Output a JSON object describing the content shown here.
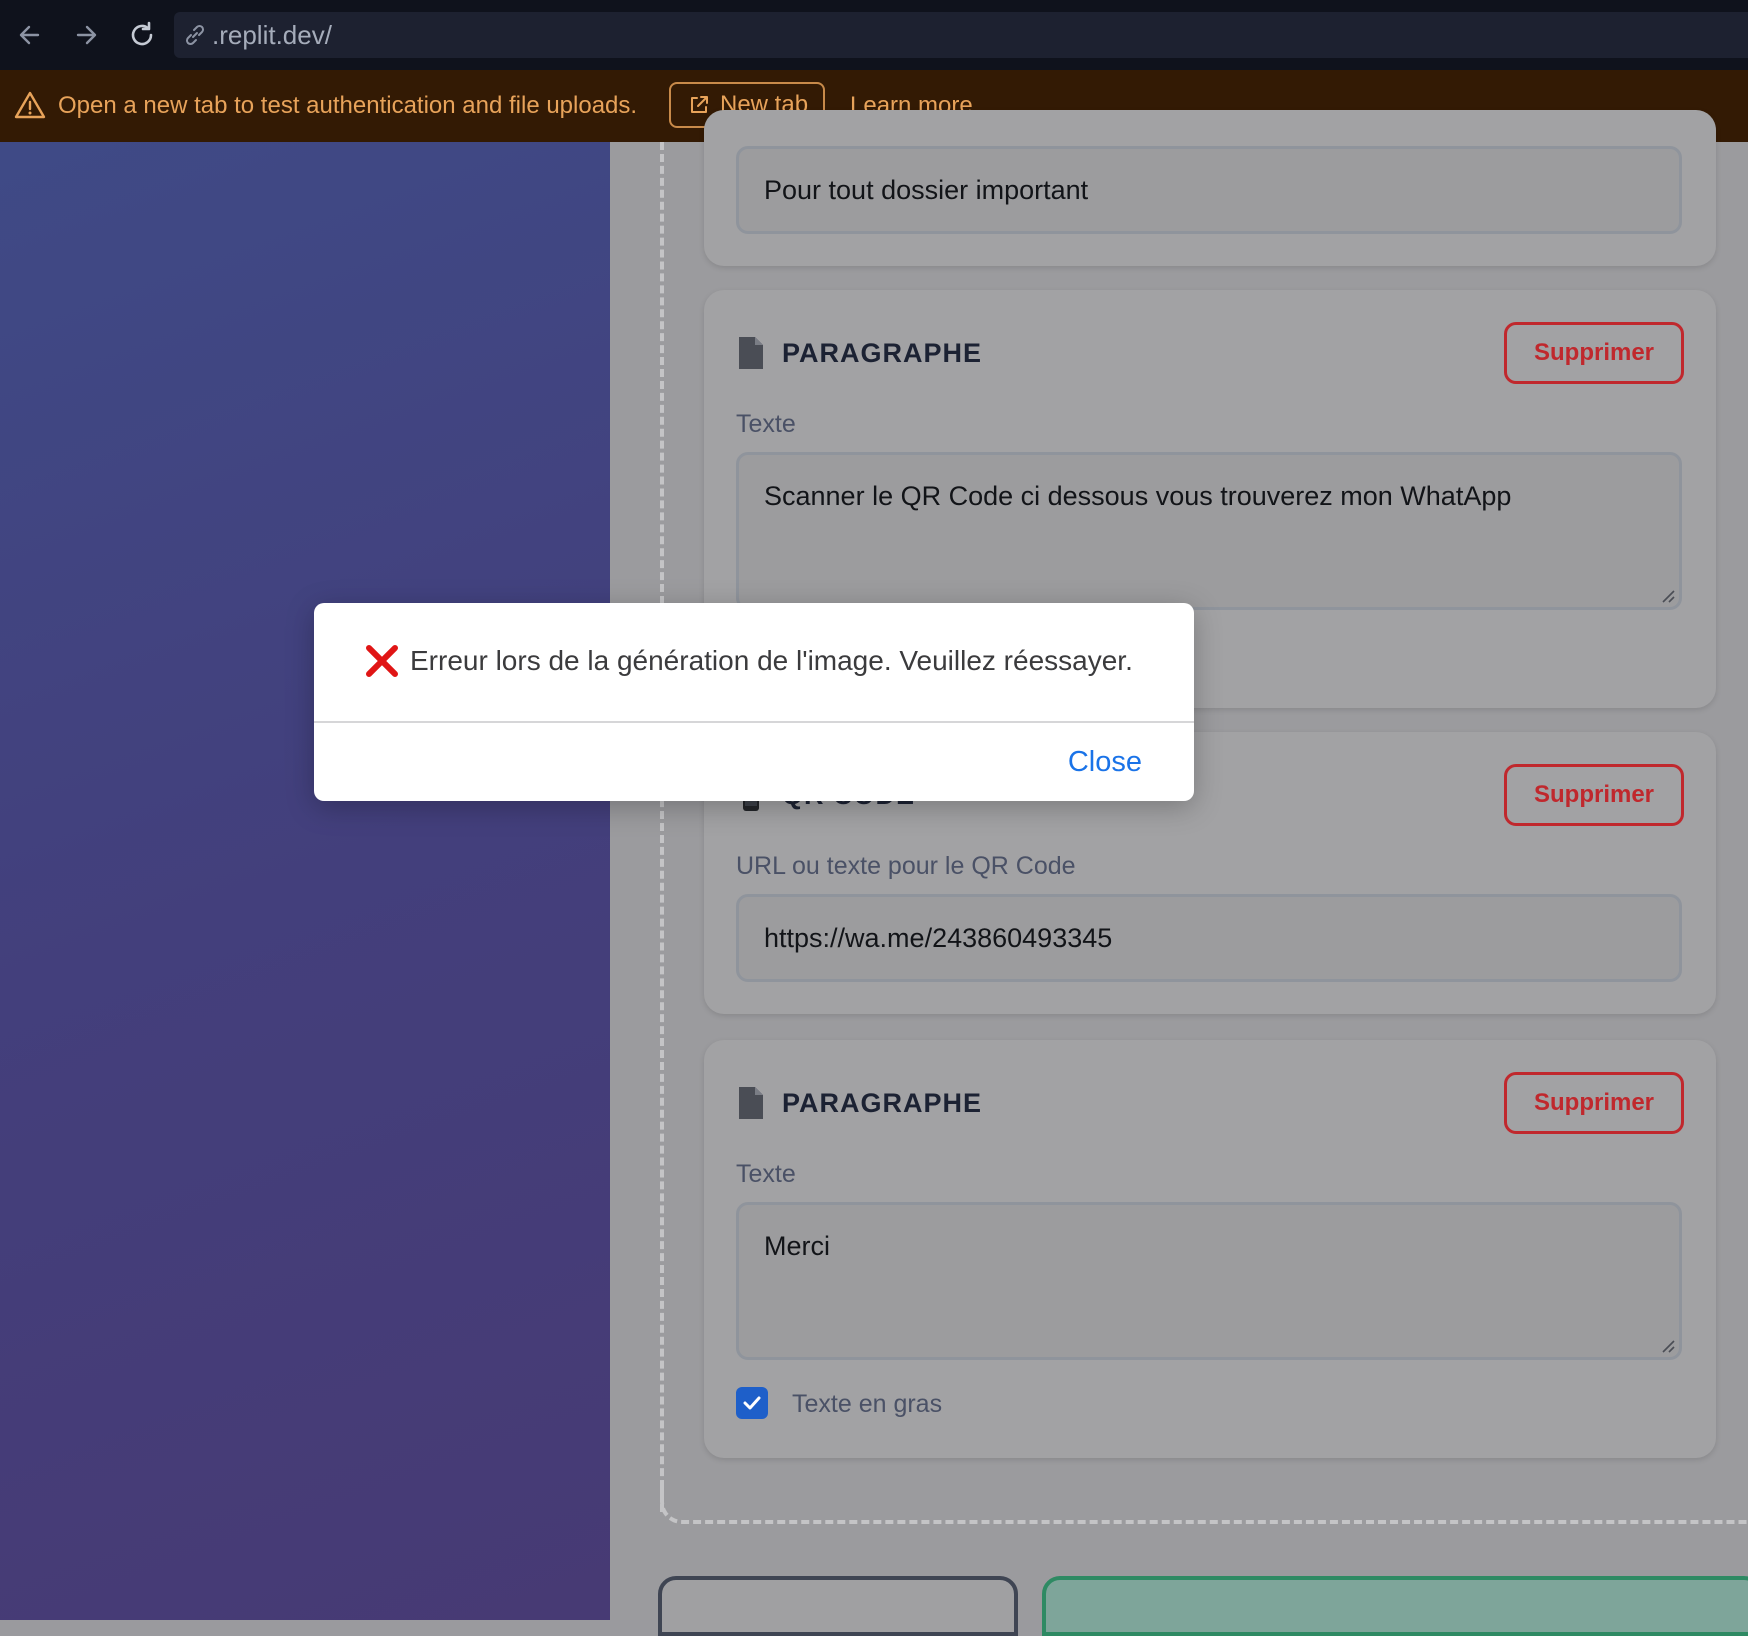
{
  "browser": {
    "url": ".replit.dev/",
    "back_icon": "arrow-left-icon",
    "forward_icon": "arrow-right-icon",
    "reload_icon": "reload-icon",
    "link_icon": "link-icon"
  },
  "banner": {
    "message": "Open a new tab to test authentication and file uploads.",
    "new_tab_label": "New tab",
    "learn_more_label": "Learn more"
  },
  "cards": [
    {
      "field_value": "Pour tout dossier important"
    },
    {
      "type_label": "PARAGRAPHE",
      "delete_label": "Supprimer",
      "field_label": "Texte",
      "field_value": "Scanner le QR Code ci dessous vous trouverez mon WhatApp"
    },
    {
      "type_label": "QR CODE",
      "delete_label": "Supprimer",
      "field_label": "URL ou texte pour le QR Code",
      "field_value": "https://wa.me/243860493345"
    },
    {
      "type_label": "PARAGRAPHE",
      "delete_label": "Supprimer",
      "field_label": "Texte",
      "field_value": "Merci",
      "checkbox_label": "Texte en gras",
      "checkbox_checked": true
    }
  ],
  "dialog": {
    "message": "Erreur lors de la génération de l'image. Veuillez réessayer.",
    "close_label": "Close"
  },
  "colors": {
    "delete": "#c0282d",
    "link": "#1a73e8",
    "banner_text": "#e8a35a",
    "checkbox": "#1e5fc9"
  }
}
